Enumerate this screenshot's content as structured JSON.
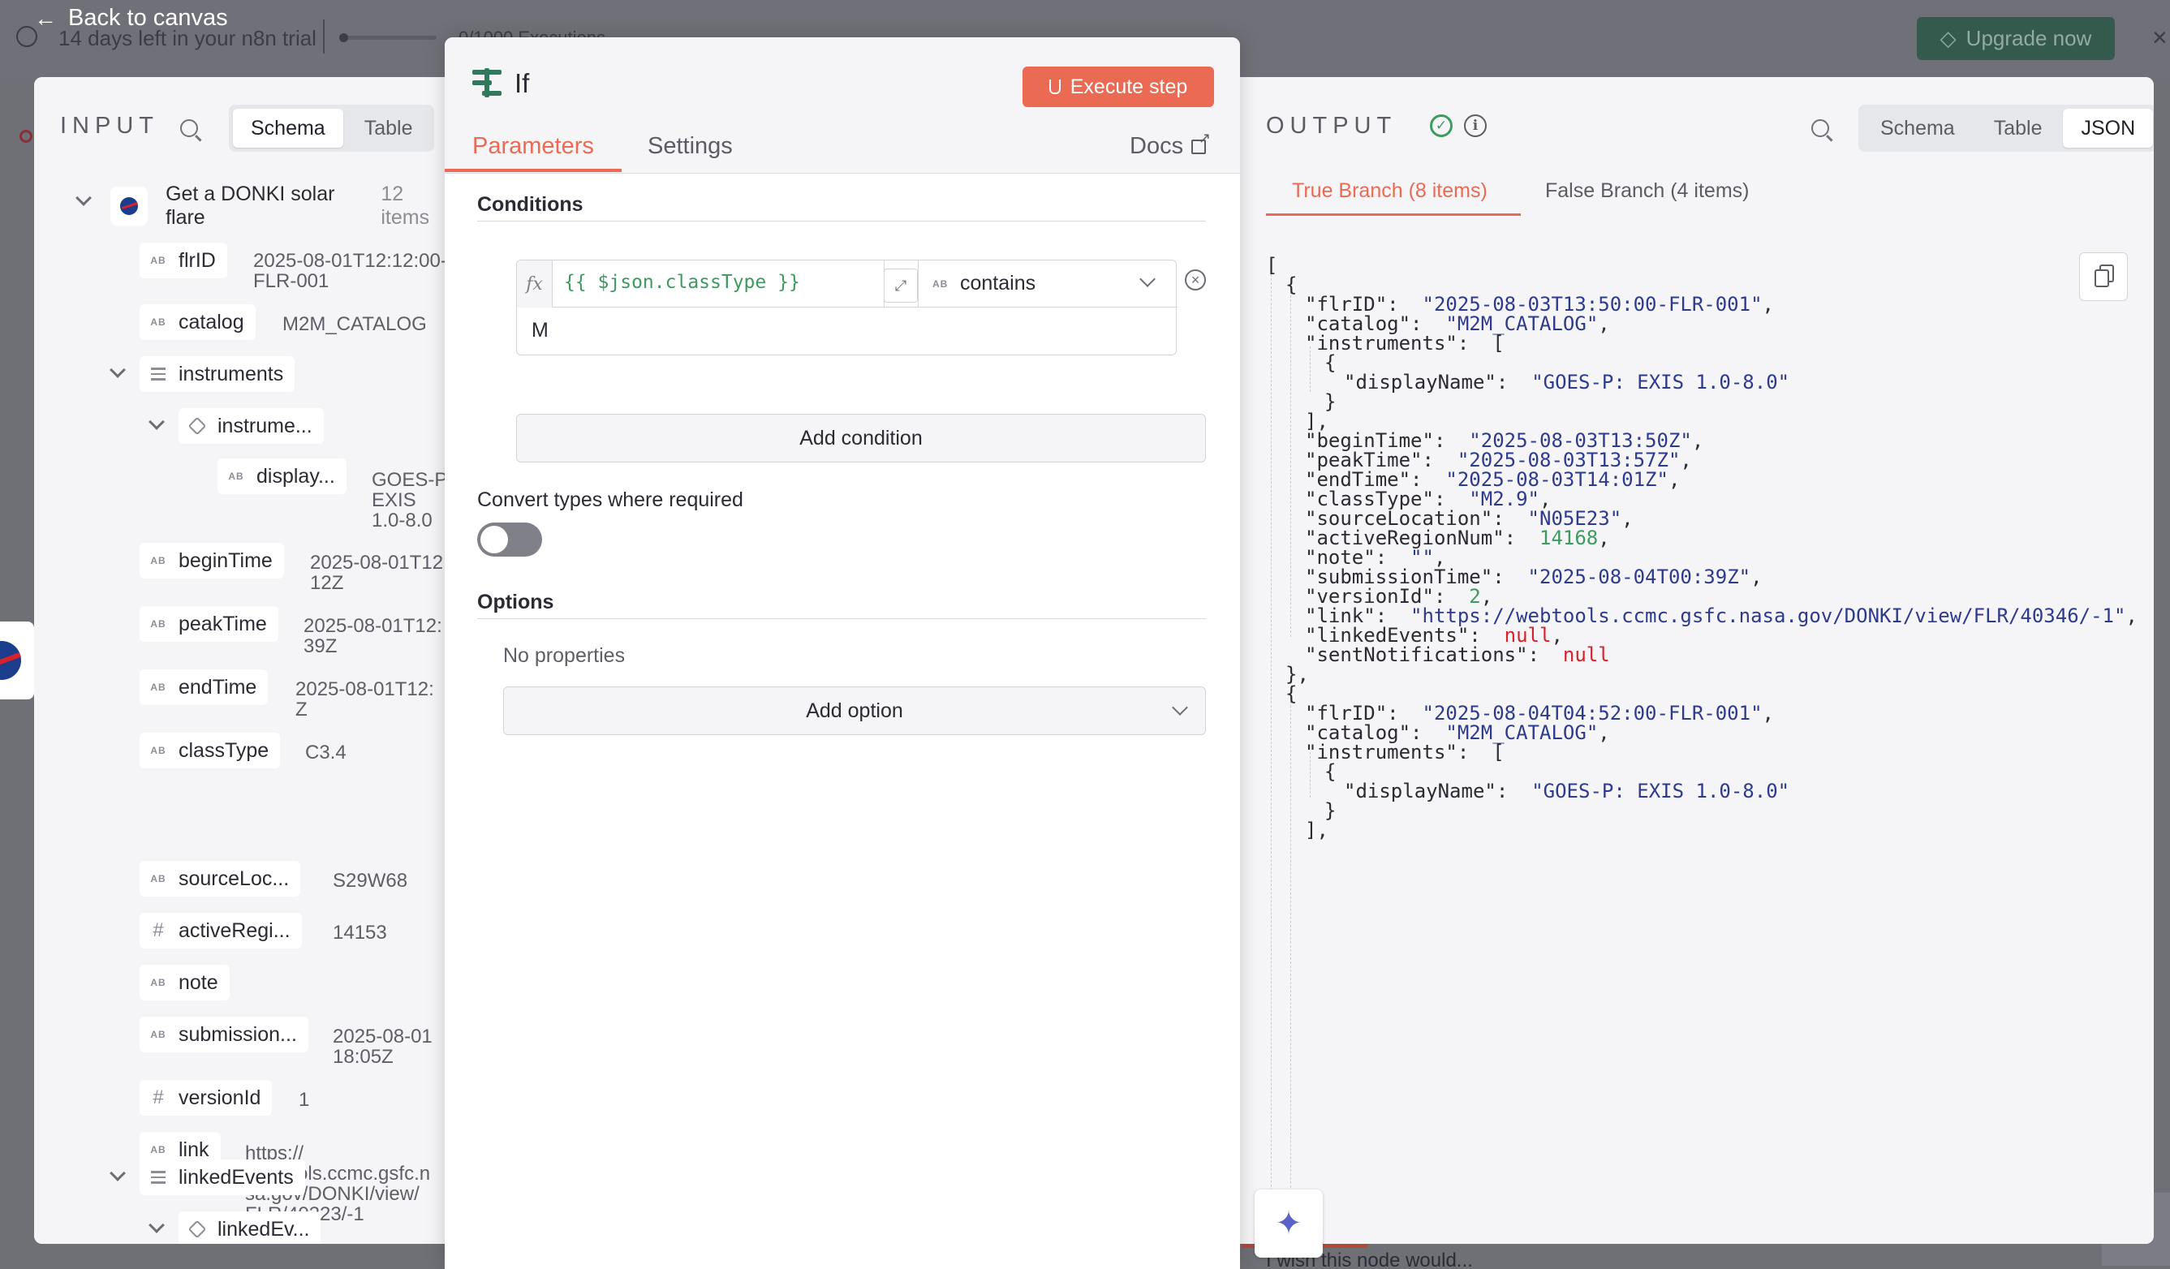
{
  "background": {
    "back_label": "Back to canvas",
    "trial_text": "14 days left in your n8n trial",
    "executions_text": "0/1000 Executions",
    "upgrade_label": "Upgrade now",
    "bottom_hint": "I wish this node would..."
  },
  "input": {
    "title": "INPUT",
    "tabs": [
      "Schema",
      "Table"
    ],
    "active_tab": "Schema",
    "source_node": "Get a DONKI solar flare",
    "source_count": "12 items",
    "fields": {
      "flrID": {
        "label": "flrID",
        "value_l1": "2025-08-01T12:12:00-",
        "value_l2": "FLR-001"
      },
      "catalog": {
        "label": "catalog",
        "value": "M2M_CATALOG"
      },
      "instruments": {
        "label": "instruments"
      },
      "instrument_item": {
        "label": "instrume..."
      },
      "displayName": {
        "label": "display...",
        "value_l1": "GOES-P:",
        "value_l2": "EXIS",
        "value_l3": "1.0-8.0"
      },
      "beginTime": {
        "label": "beginTime",
        "value_l1": "2025-08-01T12:",
        "value_l2": "12Z"
      },
      "peakTime": {
        "label": "peakTime",
        "value_l1": "2025-08-01T12:",
        "value_l2": "39Z"
      },
      "endTime": {
        "label": "endTime",
        "value_l1": "2025-08-01T12:",
        "value_l2": "Z"
      },
      "classType": {
        "label": "classType",
        "value": "C3.4"
      },
      "sourceLocation": {
        "label": "sourceLoc...",
        "value": "S29W68"
      },
      "activeRegionNum": {
        "label": "activeRegi...",
        "value": "14153"
      },
      "note": {
        "label": "note"
      },
      "submissionTime": {
        "label": "submission...",
        "value_l1": "2025-08-01",
        "value_l2": "18:05Z"
      },
      "versionId": {
        "label": "versionId",
        "value": "1"
      },
      "link": {
        "label": "link",
        "value_l1": "https://",
        "value_l2": "webtools.ccmc.gsfc.n",
        "value_l3": "sa.gov/DONKI/view/",
        "value_l4": "FLR/40323/-1"
      },
      "linkedEvents": {
        "label": "linkedEvents"
      },
      "linkedEvents_item": {
        "label": "linkedEv..."
      }
    }
  },
  "node": {
    "title": "If",
    "execute_label": "Execute step",
    "tabs": [
      "Parameters",
      "Settings"
    ],
    "active_tab": "Parameters",
    "docs_label": "Docs",
    "conditions_title": "Conditions",
    "condition": {
      "left_expression": "{{ $json.classType }}",
      "operator": "contains",
      "right_value": "M"
    },
    "add_condition_label": "Add condition",
    "convert_types_label": "Convert types where required",
    "convert_types_enabled": false,
    "options_title": "Options",
    "no_properties": "No properties",
    "add_option_label": "Add option"
  },
  "output": {
    "title": "OUTPUT",
    "tabs": [
      "Schema",
      "Table",
      "JSON"
    ],
    "active_tab": "JSON",
    "branches": [
      "True Branch (8 items)",
      "False Branch (4 items)"
    ],
    "active_branch": "True Branch (8 items)",
    "items": [
      {
        "flrID": "2025-08-03T13:50:00-FLR-001",
        "catalog": "M2M_CATALOG",
        "instruments_displayName": "GOES-P: EXIS 1.0-8.0",
        "beginTime": "2025-08-03T13:50Z",
        "peakTime": "2025-08-03T13:57Z",
        "endTime": "2025-08-03T14:01Z",
        "classType": "M2.9",
        "sourceLocation": "N05E23",
        "activeRegionNum": "14168",
        "note": "",
        "submissionTime": "2025-08-04T00:39Z",
        "versionId": "2",
        "link": "https://webtools.ccmc.gsfc.nasa.gov/DONKI/view/FLR/40346/-1",
        "linkedEvents": "null",
        "sentNotifications": "null"
      },
      {
        "flrID": "2025-08-04T04:52:00-FLR-001",
        "catalog": "M2M_CATALOG",
        "instruments_displayName": "GOES-P: EXIS 1.0-8.0"
      }
    ]
  }
}
